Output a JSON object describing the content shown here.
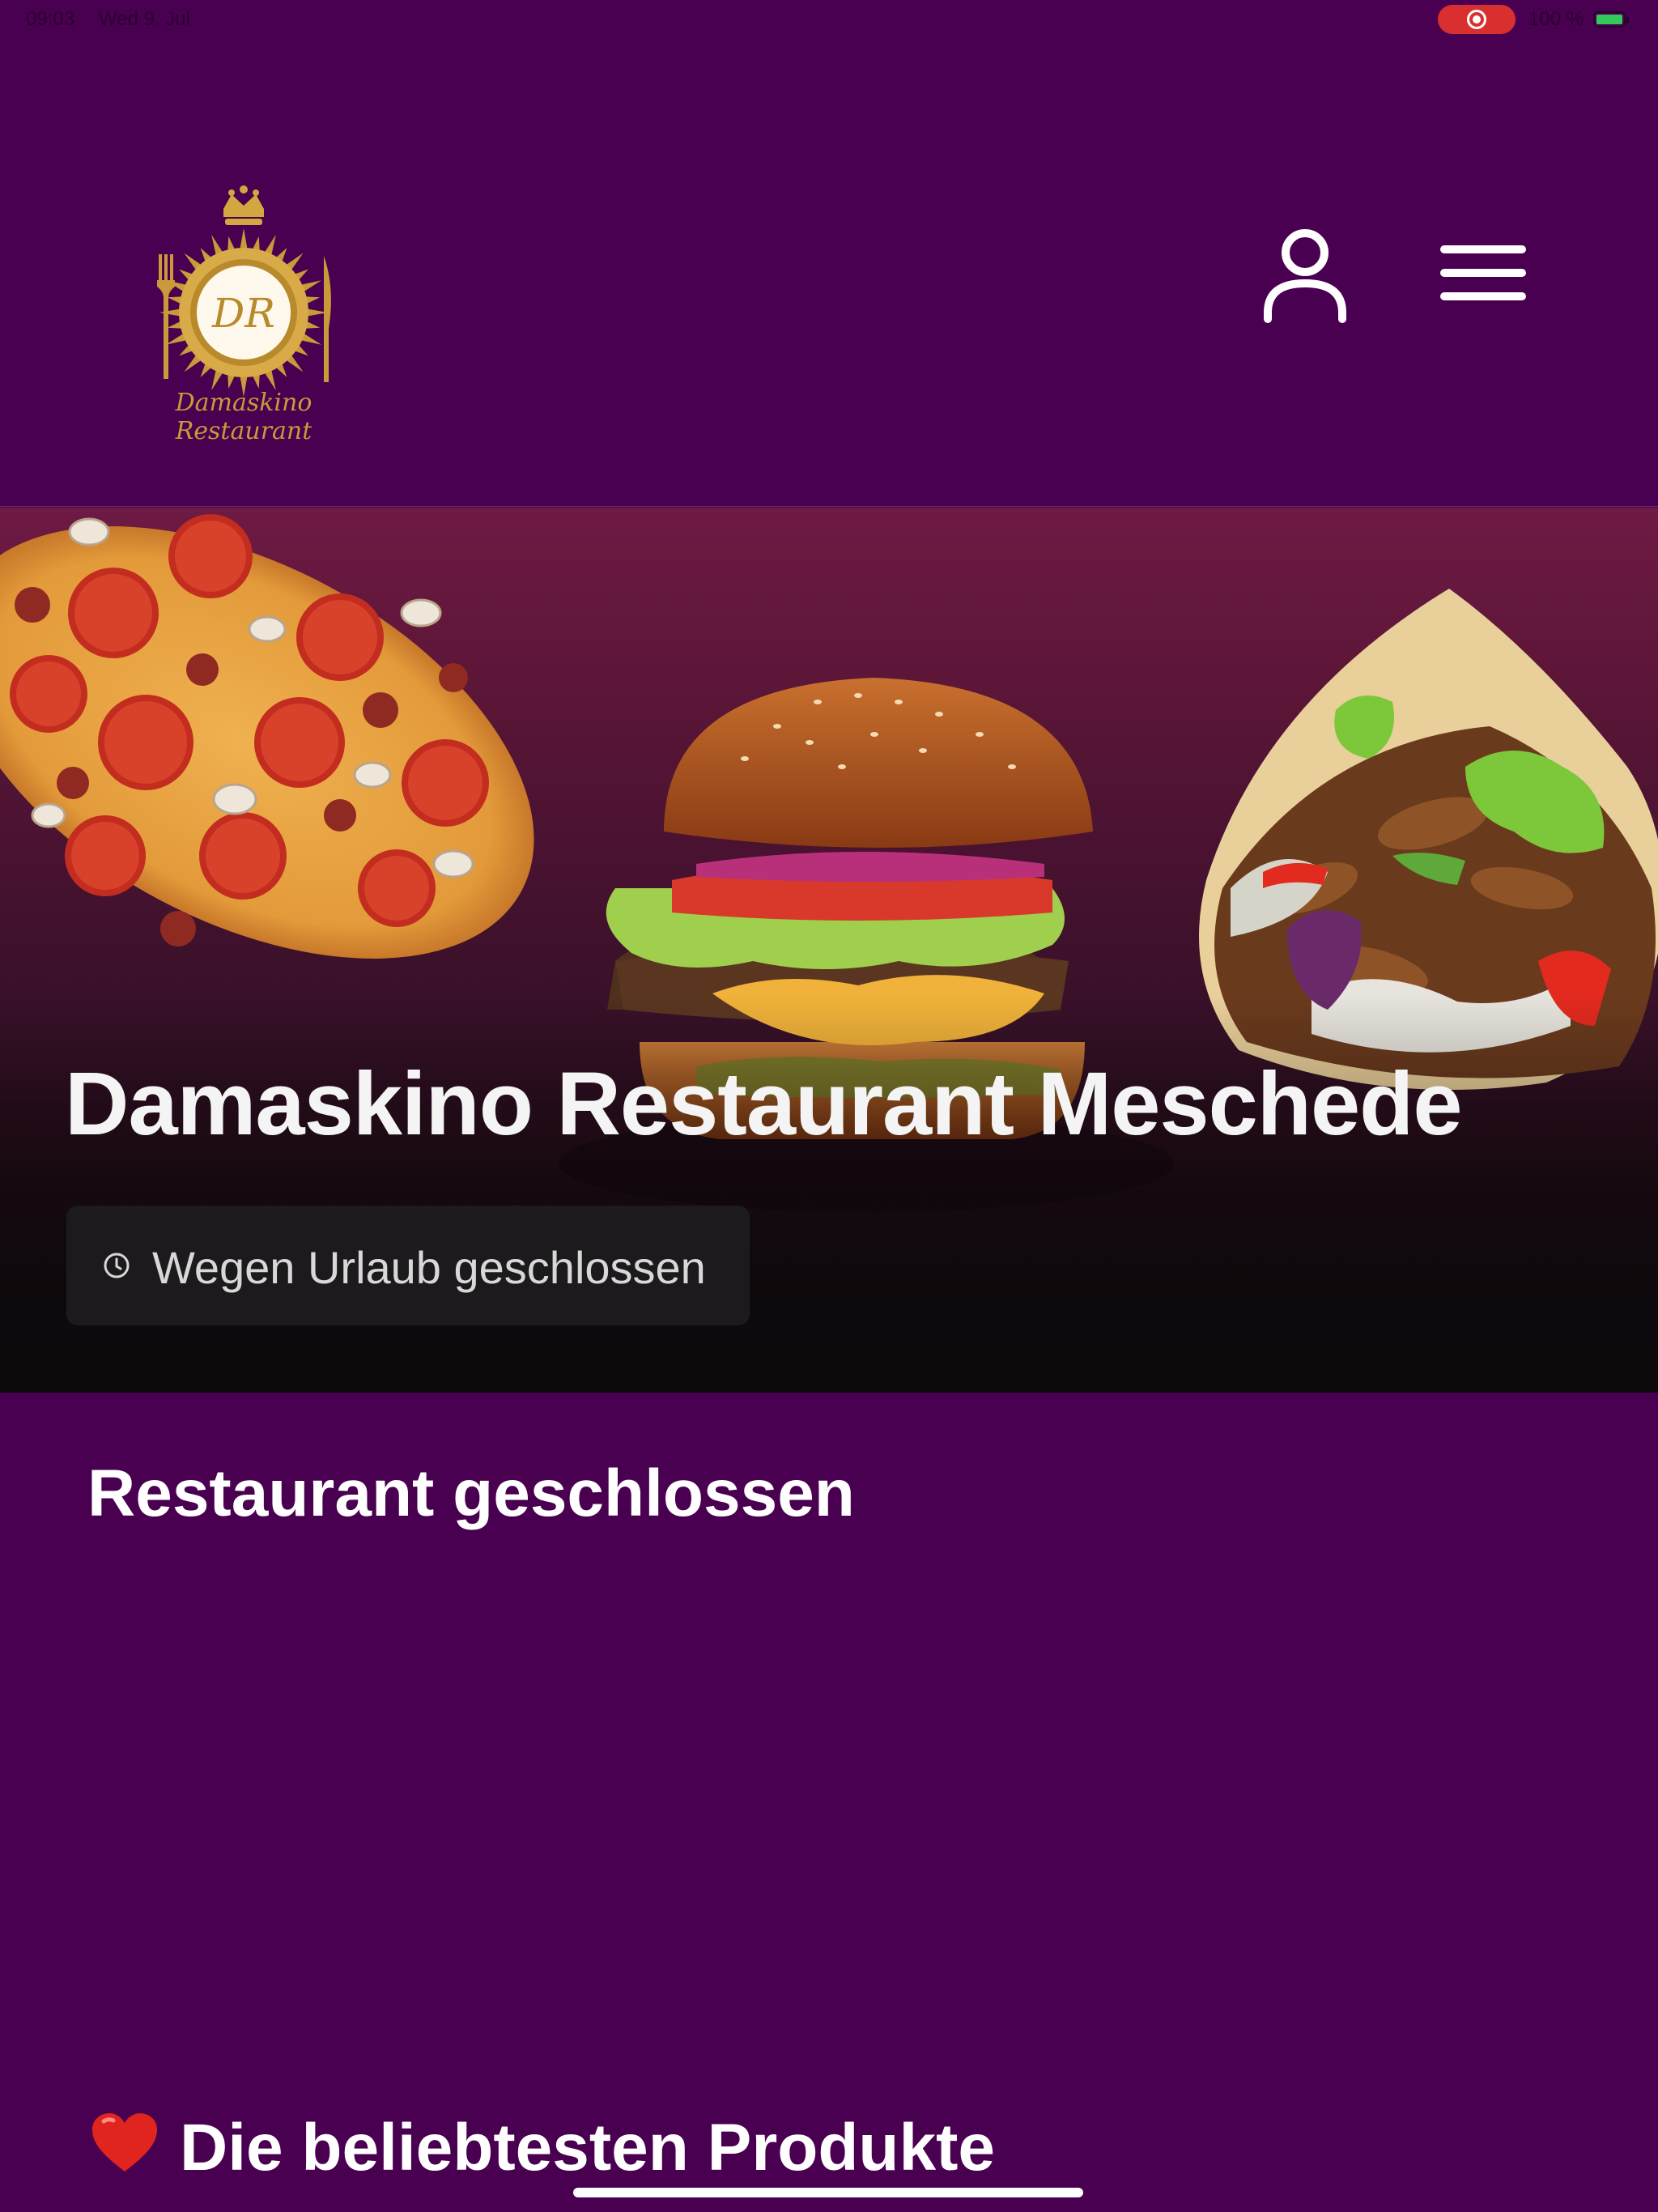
{
  "status_bar": {
    "time": "09:03",
    "date": "Wed 9. Jul",
    "battery": "100 %",
    "record_color": "#d9302f"
  },
  "header": {
    "logo_monogram": "DR",
    "logo_text": "Damaskino Restaurant",
    "user_icon": "user-icon",
    "menu_icon": "hamburger-menu-icon",
    "background": "#4a0050",
    "gold": "#c9993a"
  },
  "hero": {
    "title": "Damaskino Restaurant Meschede",
    "status_text": "Wegen Urlaub geschlossen",
    "status_icon": "clock-icon"
  },
  "main": {
    "closed_heading": "Restaurant geschlossen",
    "popular_heading": "Die beliebtesten Produkte",
    "popular_icon": "heart-icon"
  }
}
